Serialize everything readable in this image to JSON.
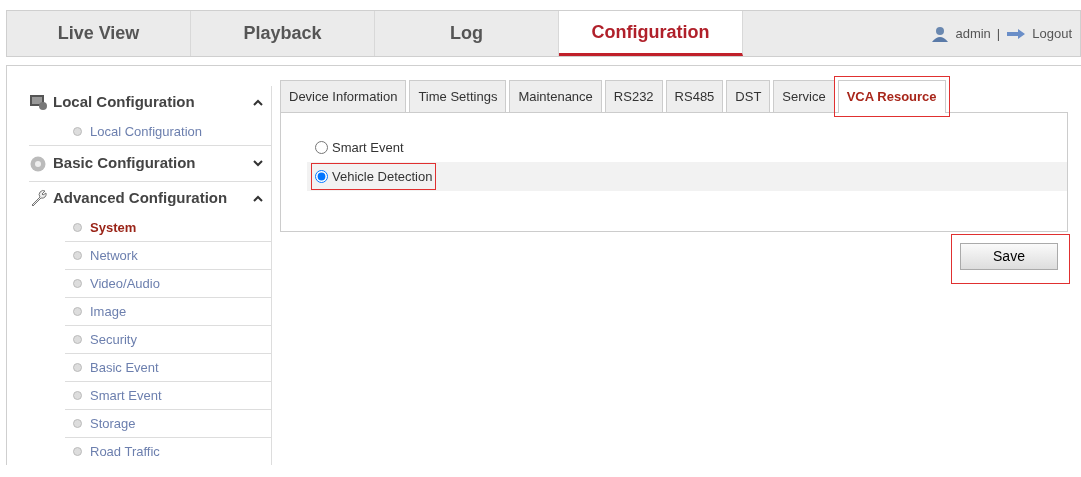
{
  "nav": {
    "tabs": [
      {
        "label": "Live View",
        "selected": false
      },
      {
        "label": "Playback",
        "selected": false
      },
      {
        "label": "Log",
        "selected": false
      },
      {
        "label": "Configuration",
        "selected": true
      }
    ],
    "user": "admin",
    "separator": "|",
    "logout": "Logout"
  },
  "sidebar": {
    "groups": [
      {
        "title": "Local Configuration",
        "kind": "monitor",
        "expanded": true,
        "items": [
          {
            "label": "Local Configuration",
            "selected": false
          }
        ]
      },
      {
        "title": "Basic Configuration",
        "kind": "gear",
        "expanded": false
      },
      {
        "title": "Advanced Configuration",
        "kind": "wrench",
        "expanded": true,
        "items": [
          {
            "label": "System",
            "selected": true
          },
          {
            "label": "Network",
            "selected": false
          },
          {
            "label": "Video/Audio",
            "selected": false
          },
          {
            "label": "Image",
            "selected": false
          },
          {
            "label": "Security",
            "selected": false
          },
          {
            "label": "Basic Event",
            "selected": false
          },
          {
            "label": "Smart Event",
            "selected": false
          },
          {
            "label": "Storage",
            "selected": false
          },
          {
            "label": "Road Traffic",
            "selected": false
          }
        ]
      }
    ]
  },
  "tabs": [
    {
      "label": "Device Information",
      "selected": false,
      "highlighted": false
    },
    {
      "label": "Time Settings",
      "selected": false,
      "highlighted": false
    },
    {
      "label": "Maintenance",
      "selected": false,
      "highlighted": false
    },
    {
      "label": "RS232",
      "selected": false,
      "highlighted": false
    },
    {
      "label": "RS485",
      "selected": false,
      "highlighted": false
    },
    {
      "label": "DST",
      "selected": false,
      "highlighted": false
    },
    {
      "label": "Service",
      "selected": false,
      "highlighted": false
    },
    {
      "label": "VCA Resource",
      "selected": true,
      "highlighted": true
    }
  ],
  "options": [
    {
      "label": "Smart Event",
      "selected": false
    },
    {
      "label": "Vehicle Detection",
      "selected": true,
      "highlighted": true
    }
  ],
  "save": {
    "label": "Save",
    "highlighted": true
  }
}
